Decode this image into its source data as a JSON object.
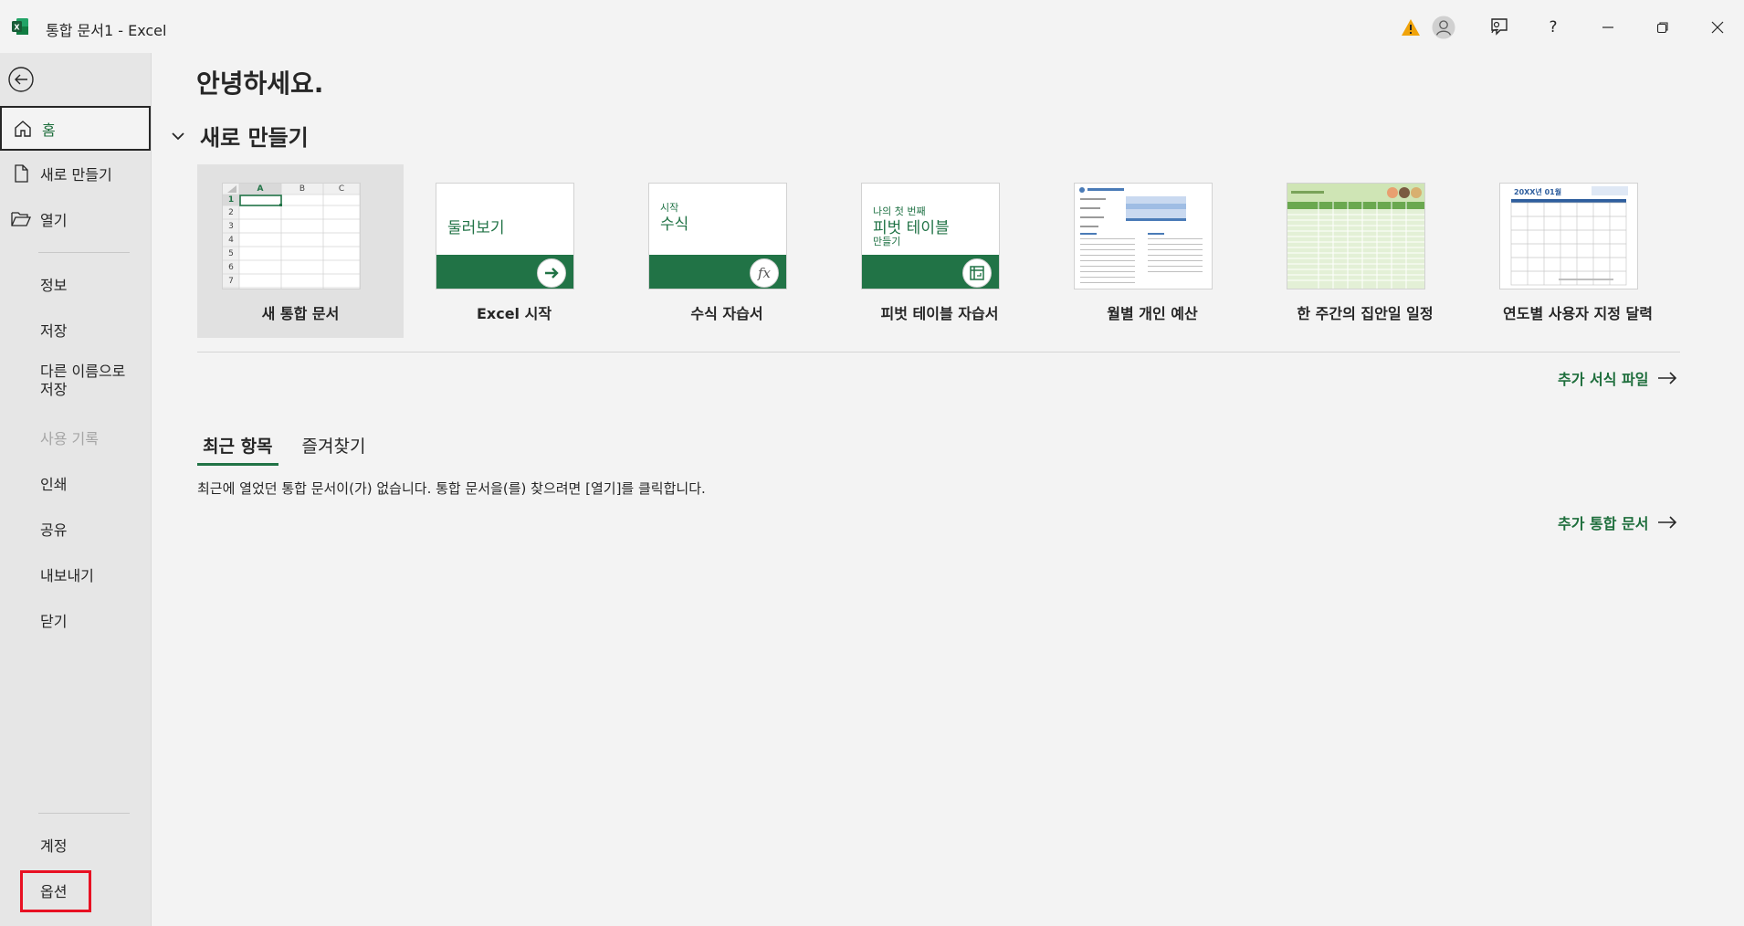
{
  "window": {
    "title": "통합 문서1  -  Excel",
    "app_icon": "excel-logo",
    "controls": [
      "warning-icon",
      "account-avatar",
      "feedback-icon",
      "help-icon",
      "minimize-icon",
      "restore-icon",
      "close-icon"
    ],
    "help_label": "?"
  },
  "sidebar": {
    "back_icon": "back-arrow-icon",
    "items": [
      {
        "label": "홈",
        "icon": "home-icon",
        "active": true
      },
      {
        "label": "새로 만들기",
        "icon": "new-doc-icon"
      },
      {
        "label": "열기",
        "icon": "folder-open-icon"
      },
      {
        "label": "정보"
      },
      {
        "label": "저장"
      },
      {
        "label": "다른 이름으로\n저장"
      },
      {
        "label": "사용 기록",
        "disabled": true
      },
      {
        "label": "인쇄"
      },
      {
        "label": "공유"
      },
      {
        "label": "내보내기"
      },
      {
        "label": "닫기"
      },
      {
        "label": "계정"
      },
      {
        "label": "옵션",
        "highlighted": true
      }
    ]
  },
  "main": {
    "greeting": "안녕하세요.",
    "new_section": {
      "title": "새로 만들기",
      "templates": [
        {
          "name": "새 통합 문서",
          "selected": true
        },
        {
          "name": "Excel 시작",
          "tile_text": "둘러보기"
        },
        {
          "name": "수식 자습서",
          "tile_small": "시작",
          "tile_text": "수식",
          "badge": "fx"
        },
        {
          "name": "피벗 테이블 자습서",
          "tile_small": "나의 첫 번째",
          "tile_text": "피벗 테이블",
          "tile_sub": "만들기"
        },
        {
          "name": "월별 개인 예산"
        },
        {
          "name": "한 주간의 집안일 일정"
        },
        {
          "name": "연도별 사용자 지정 달력",
          "thumb_text": "20XX년 01월"
        }
      ],
      "sheet_columns": [
        "A",
        "B",
        "C"
      ],
      "sheet_rows": [
        "1",
        "2",
        "3",
        "4",
        "5",
        "6",
        "7"
      ],
      "more_templates": "추가 서식 파일"
    },
    "tabs": [
      {
        "label": "최근 항목",
        "active": true
      },
      {
        "label": "즐겨찾기"
      }
    ],
    "empty_message": "최근에 열었던 통합 문서이(가) 없습니다. 통합 문서을(를) 찾으려면 [열기]를 클릭합니다.",
    "more_workbooks": "추가 통합 문서"
  },
  "colors": {
    "accent": "#217346",
    "link": "#1e6e3c",
    "highlight_box": "#e81123",
    "warning": "#f0a30a"
  }
}
